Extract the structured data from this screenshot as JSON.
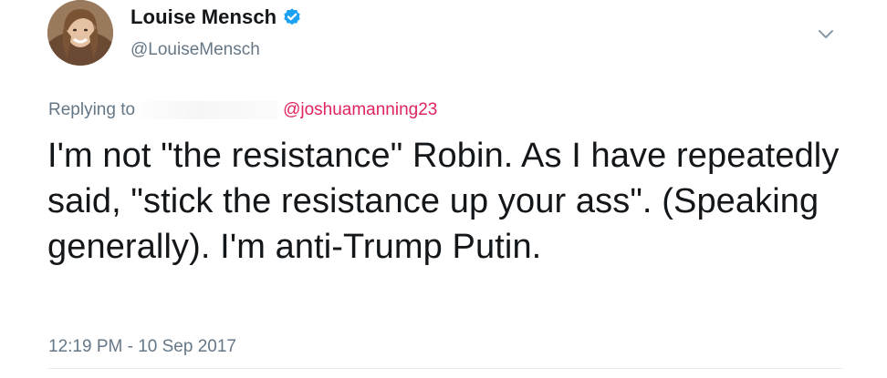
{
  "author": {
    "display_name": "Louise Mensch",
    "handle": "@LouiseMensch",
    "verified": true
  },
  "reply": {
    "prefix": "Replying to",
    "mention": "@joshuamanning23"
  },
  "tweet": {
    "text": "I'm not \"the resistance\" Robin. As I have repeatedly said, \"stick the resistance up your ass\". (Speaking generally). I'm anti-Trump Putin.",
    "timestamp": "12:19 PM - 10 Sep 2017"
  },
  "icons": {
    "verified": "verified-badge-icon",
    "menu": "chevron-down-icon"
  },
  "colors": {
    "text_primary": "#14171a",
    "text_secondary": "#657786",
    "verified_blue": "#1da1f2",
    "mention": "#e0245e"
  }
}
